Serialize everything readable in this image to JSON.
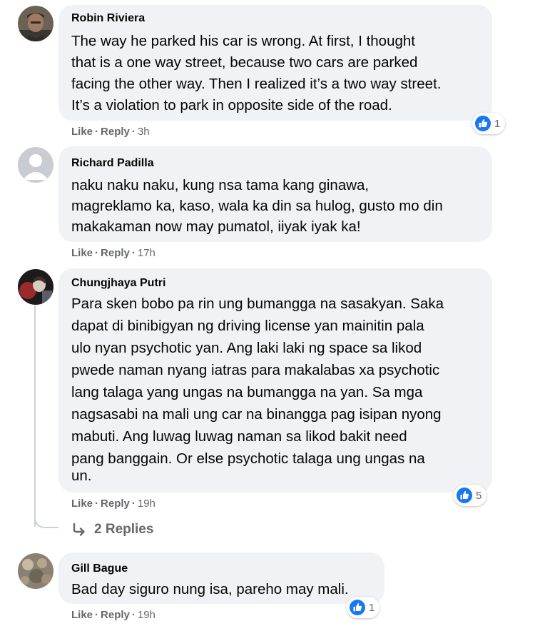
{
  "comments": [
    {
      "author": "Robin Riviera",
      "lines": [
        "The way he parked his car is wrong. At first, I thought",
        "that is a one way street, because two cars are parked",
        "facing the other way. Then I realized it’s a two way street.",
        "It’s a violation to park in opposite side of the road."
      ],
      "like_label": "Like",
      "reply_label": "Reply",
      "time": "3h",
      "reaction_count": "1"
    },
    {
      "author": "Richard Padilla",
      "lines": [
        "naku naku naku, kung nsa tama kang ginawa,",
        "magreklamo ka, kaso, wala ka din sa hulog, gusto mo din",
        "makakaman now may pumatol, iiyak iyak ka!"
      ],
      "like_label": "Like",
      "reply_label": "Reply",
      "time": "17h"
    },
    {
      "author": "Chungjhaya Putri",
      "lines": [
        "Para sken bobo pa rin ung bumangga na sasakyan. Saka",
        "dapat di binibigyan ng driving license yan mainitin pala",
        "ulo nyan psychotic yan. Ang laki laki ng space sa likod",
        "pwede naman nyang iatras para makalabas xa psychotic",
        "lang talaga yang ungas na bumangga na yan. Sa mga",
        "nagsasabi na mali ung car na binangga pag isipan nyong",
        "mabuti. Ang luwag luwag naman sa likod bakit need",
        "pang banggain. Or else psychotic talaga ung ungas na",
        "un."
      ],
      "like_label": "Like",
      "reply_label": "Reply",
      "time": "19h",
      "reaction_count": "5",
      "replies_label": "2 Replies"
    },
    {
      "author": "Gill Bague",
      "lines": [
        "Bad day siguro nung isa, pareho may mali."
      ],
      "like_label": "Like",
      "reply_label": "Reply",
      "time": "19h",
      "reaction_count": "1"
    }
  ],
  "icons": {
    "like_reaction": "like-reaction-icon",
    "reply_arrow": "reply-arrow-icon"
  },
  "colors": {
    "bubble": "#f0f2f5",
    "secondary_text": "#65676b",
    "like_blue": "#1877f2"
  }
}
